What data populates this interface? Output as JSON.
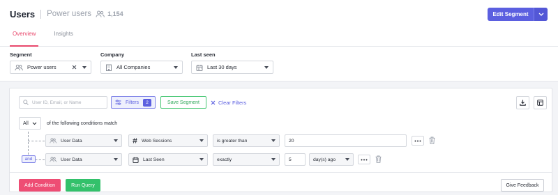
{
  "header": {
    "title": "Users",
    "segment_name": "Power users",
    "user_count": "1,154",
    "edit_segment_label": "Edit Segment"
  },
  "tabs": [
    {
      "label": "Overview",
      "active": true
    },
    {
      "label": "Insights",
      "active": false
    }
  ],
  "filters": {
    "segment": {
      "label": "Segment",
      "value": "Power users",
      "icon": "users-icon"
    },
    "company": {
      "label": "Company",
      "value": "All Companies",
      "icon": "building-icon"
    },
    "last_seen": {
      "label": "Last seen",
      "value": "Last 30 days",
      "icon": "calendar-icon"
    }
  },
  "query": {
    "search_placeholder": "User ID, Email, or Name",
    "filters_label": "Filters",
    "filters_count": "2",
    "save_segment_label": "Save Segment",
    "clear_filters_label": "Clear Filters",
    "match_mode": "All",
    "match_text": "of the following conditions match",
    "joiner": "and",
    "conditions": [
      {
        "source": "User Data",
        "field": "Web Sessions",
        "field_icon": "hash-icon",
        "operator": "is greater than",
        "value": "20"
      },
      {
        "source": "User Data",
        "field": "Last Seen",
        "field_icon": "calendar-icon",
        "operator": "exactly",
        "value": "5",
        "unit": "day(s) ago"
      }
    ],
    "add_condition_label": "Add Condition",
    "run_query_label": "Run Query",
    "feedback_label": "Give Feedback"
  },
  "colors": {
    "accent": "#5b5fe0",
    "tab_active": "#e8476b",
    "add_condition": "#ee4d74",
    "run_query": "#33c16b",
    "save_segment": "#48c774"
  }
}
